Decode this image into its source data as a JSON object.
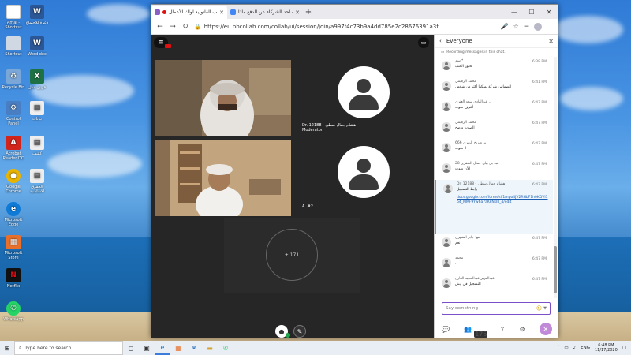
{
  "browser": {
    "tabs": [
      {
        "label": "الجوانب القانونية لواك الأعمال",
        "active": true,
        "recording": true
      },
      {
        "label": "لو تخلف احد الشركاء عن الدفع ماذا...",
        "active": false,
        "recording": false
      }
    ],
    "url": "https://eu.bbcollab.com/collab/ui/session/join/a997f4c73b9a4dd785e2c28676391a3f",
    "new_tab": "+",
    "window_controls": {
      "minimize": "—",
      "maximize": "☐",
      "close": "✕"
    }
  },
  "collab": {
    "tiles": [
      {
        "label_line1": "",
        "label_line2": ""
      },
      {
        "label_line1": "Dr. 12188 - هشام جمال سطي",
        "label_line2": "Moderator"
      },
      {
        "label_line1": "",
        "label_line2": ""
      },
      {
        "label_line1": "A. #2",
        "label_line2": ""
      }
    ],
    "more_count": "+ 171"
  },
  "chat": {
    "title": "Everyone",
    "recording_note": "Recording messages in this chat.",
    "messages": [
      {
        "name": "أسم*",
        "time": "6:38 PM",
        "text": "تحيور الكتب"
      },
      {
        "name": "محمد الرقيمي",
        "time": "6:41 PM",
        "text": "الضمانين شركة يملكها أكثر من شخص"
      },
      {
        "name": "د. عبدالهادي سعد العنزي",
        "time": "6:47 PM",
        "text": "أعرف صوت"
      },
      {
        "name": "محمد الرقيمي",
        "time": "6:47 PM",
        "text": "الصوت واضح"
      },
      {
        "name": "زيد طريخ الزيري 666",
        "time": "6:47 PM",
        "text": "لا صوت"
      },
      {
        "name": "عبد بن بيان جمال العنقري 28",
        "time": "6:47 PM",
        "text": "الأن صوت"
      },
      {
        "name": "Dr. 12188 - هشام جمال سطي",
        "time": "6:47 PM",
        "text": "رابط التسجيل",
        "link": "docs.google.com/forms/d/1mpo4JV2RHbF1h0KDVI1b4_MMF9Yw6a7aKFNsIII_4/edit",
        "highlight": true
      },
      {
        "name": "مها جابر الشهري",
        "time": "6:47 PM",
        "text": "نعم"
      },
      {
        "name": "محمد",
        "time": "6:47 PM",
        "text": "."
      },
      {
        "name": "عبدالعزيز عبدالمجيد القارح",
        "time": "6:47 PM",
        "text": "التسجيل في ايش"
      }
    ],
    "input_placeholder": "Say something",
    "participants_badge": "175"
  },
  "desktop": {
    "icons": [
      {
        "label": "Amal - Shortcut",
        "glyph": "",
        "color": "#ffffff"
      },
      {
        "label": "دعوة للاجتماع",
        "glyph": "W",
        "color": "#2b5797"
      },
      {
        "label": "Shortcut",
        "glyph": "",
        "color": "#cfd8e3"
      },
      {
        "label": "Word doc",
        "glyph": "W",
        "color": "#2b5797"
      },
      {
        "label": "Recycle Bin",
        "glyph": "♻",
        "color": "#7aa7d8"
      },
      {
        "label": "فريق عمل",
        "glyph": "X",
        "color": "#1e7145"
      },
      {
        "label": "Control Panel",
        "glyph": "⚙",
        "color": "#4a7ec2"
      },
      {
        "label": "بيانات",
        "glyph": "▤",
        "color": "#eeeeee"
      },
      {
        "label": "Acrobat Reader DC",
        "glyph": "A",
        "color": "#d1251c"
      },
      {
        "label": "كشف",
        "glyph": "▤",
        "color": "#eeeeee"
      },
      {
        "label": "Google Chrome",
        "glyph": "●",
        "color": "#e9b400"
      },
      {
        "label": "الحقوق الأساسية",
        "glyph": "▤",
        "color": "#eeeeee"
      },
      {
        "label": "Microsoft Edge",
        "glyph": "e",
        "color": "#0f7bd6"
      },
      {
        "label": "Microsoft Store",
        "glyph": "▦",
        "color": "#e8702a"
      },
      {
        "label": "Netflix",
        "glyph": "N",
        "color": "#111111"
      },
      {
        "label": "WhatsApp",
        "glyph": "✆",
        "color": "#25d366"
      }
    ]
  },
  "taskbar": {
    "search_placeholder": "Type here to search",
    "time": "6:48 PM",
    "date": "11/17/2020",
    "language": "ENG"
  }
}
